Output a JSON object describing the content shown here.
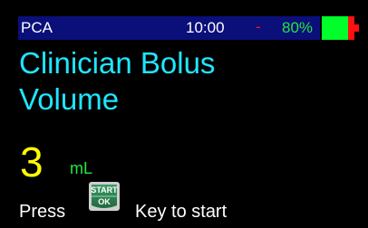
{
  "status": {
    "mode": "PCA",
    "time": "10:00",
    "separator": "-",
    "battery_percent": "80%",
    "battery_level": 0.8
  },
  "screen": {
    "title_line1": "Clinician Bolus",
    "title_line2": "Volume",
    "value": "3",
    "unit": "mL",
    "prompt_before": "Press",
    "key_top": "START",
    "key_bottom": "OK",
    "prompt_after": "Key to start"
  },
  "colors": {
    "background": "#000000",
    "status_bar": "#0b0f7a",
    "title": "#1fe6ff",
    "value": "#ffff00",
    "unit": "#22e640",
    "battery_green": "#00ff2a",
    "battery_red": "#ff1010"
  },
  "icons": {
    "key": "start-ok-key-icon",
    "battery": "battery-icon"
  }
}
